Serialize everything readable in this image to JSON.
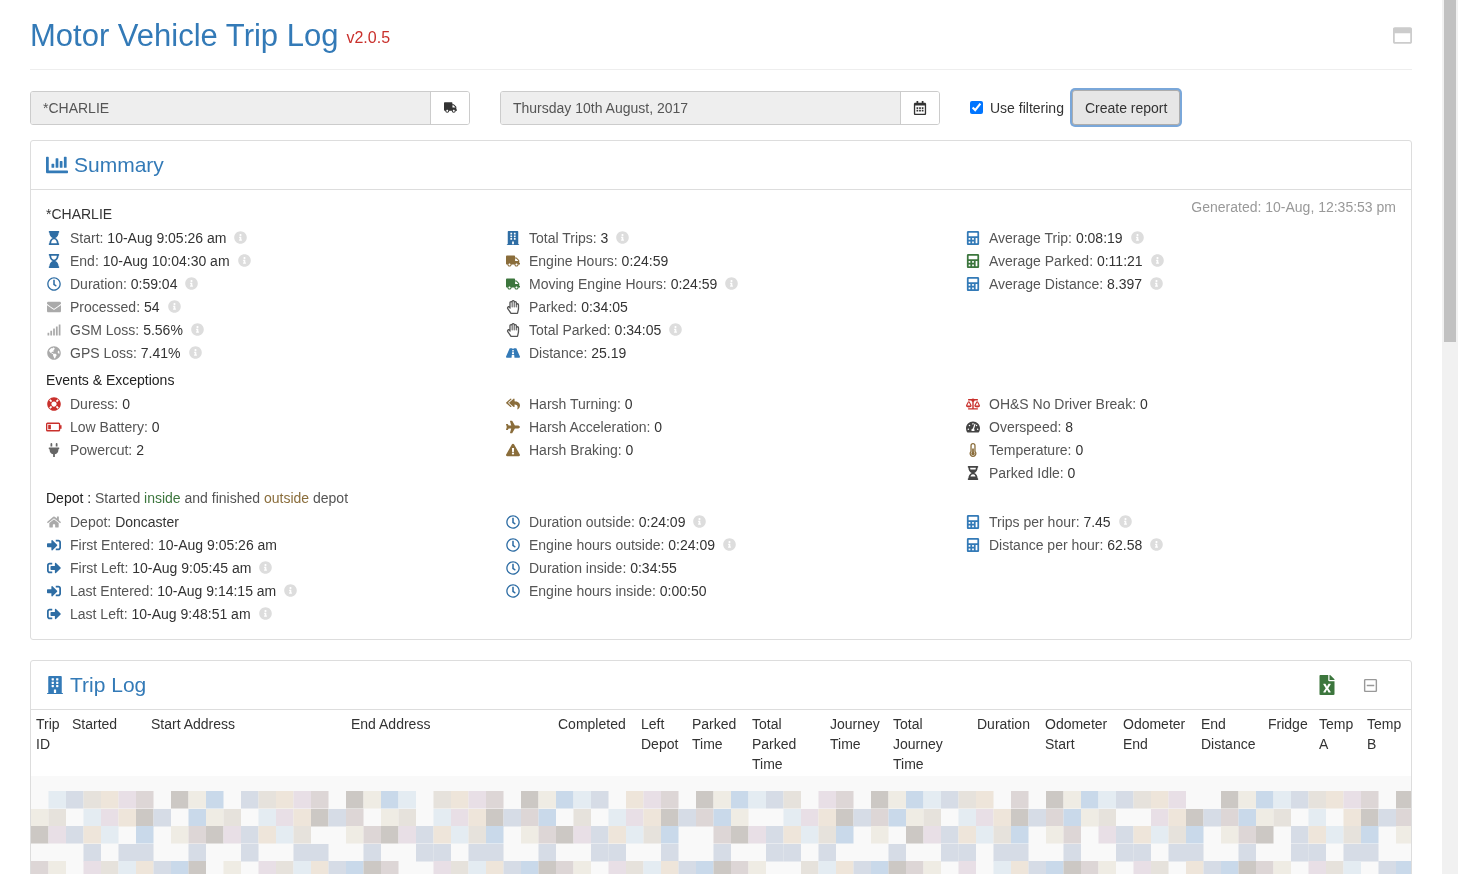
{
  "header": {
    "title": "Motor Vehicle Trip Log",
    "version": "v2.0.5"
  },
  "toolbar": {
    "vehicle_field": {
      "value": "*CHARLIE"
    },
    "date_field": {
      "value": "Thursday 10th August, 2017"
    },
    "use_filtering": {
      "label": "Use filtering",
      "checked": true
    },
    "create_report": {
      "label": "Create report"
    }
  },
  "summary": {
    "title": "Summary",
    "vehicle": "*CHARLIE",
    "generated": "Generated: 10-Aug, 12:35:53 pm",
    "groups": [
      {
        "columns": [
          [
            {
              "label": "Start:",
              "value": "10-Aug 9:05:26 am",
              "info": true
            },
            {
              "label": "End:",
              "value": "10-Aug 10:04:30 am",
              "info": true
            },
            {
              "label": "Duration:",
              "value": "0:59:04",
              "info": true
            },
            {
              "label": "Processed:",
              "value": "54",
              "info": true
            },
            {
              "label": "GSM Loss:",
              "value": "5.56%",
              "info": true
            },
            {
              "label": "GPS Loss:",
              "value": "7.41%",
              "info": true
            }
          ],
          [
            {
              "label": "Total Trips:",
              "value": "3",
              "info": true
            },
            {
              "label": "Engine Hours:",
              "value": "0:24:59",
              "info": false
            },
            {
              "label": "Moving Engine Hours:",
              "value": "0:24:59",
              "info": true
            },
            {
              "label": "Parked:",
              "value": "0:34:05",
              "info": false
            },
            {
              "label": "Total Parked:",
              "value": "0:34:05",
              "info": true
            },
            {
              "label": "Distance:",
              "value": "25.19",
              "info": false
            }
          ],
          [
            {
              "label": "Average Trip:",
              "value": "0:08:19",
              "info": true
            },
            {
              "label": "Average Parked:",
              "value": "0:11:21",
              "info": true
            },
            {
              "label": "Average Distance:",
              "value": "8.397",
              "info": true
            }
          ]
        ]
      },
      {
        "heading": [
          {
            "text": "Events & Exceptions",
            "kind": "plain"
          }
        ],
        "columns": [
          [
            {
              "label": "Duress:",
              "value": "0",
              "info": false
            },
            {
              "label": "Low Battery:",
              "value": "0",
              "info": false
            },
            {
              "label": "Powercut:",
              "value": "2",
              "info": false
            }
          ],
          [
            {
              "label": "Harsh Turning:",
              "value": "0",
              "info": false
            },
            {
              "label": "Harsh Acceleration:",
              "value": "0",
              "info": false
            },
            {
              "label": "Harsh Braking:",
              "value": "0",
              "info": false
            }
          ],
          [
            {
              "label": "OH&S No Driver Break:",
              "value": "0",
              "info": false
            },
            {
              "label": "Overspeed:",
              "value": "8",
              "info": false
            },
            {
              "label": "Temperature:",
              "value": "0",
              "info": false
            },
            {
              "label": "Parked Idle:",
              "value": "0",
              "info": false
            }
          ]
        ]
      },
      {
        "heading": [
          {
            "text": "Depot : ",
            "kind": "plain"
          },
          {
            "text": "Started ",
            "kind": "muted"
          },
          {
            "text": "inside",
            "kind": "good"
          },
          {
            "text": " and finished ",
            "kind": "muted"
          },
          {
            "text": "outside",
            "kind": "warn"
          },
          {
            "text": " depot",
            "kind": "muted"
          }
        ],
        "columns": [
          [
            {
              "label": "Depot:",
              "value": "Doncaster",
              "info": false
            },
            {
              "label": "First Entered:",
              "value": "10-Aug 9:05:26 am",
              "info": false
            },
            {
              "label": "First Left:",
              "value": "10-Aug 9:05:45 am",
              "info": true
            },
            {
              "label": "Last Entered:",
              "value": "10-Aug 9:14:15 am",
              "info": true
            },
            {
              "label": "Last Left:",
              "value": "10-Aug 9:48:51 am",
              "info": true
            }
          ],
          [
            {
              "label": "Duration outside:",
              "value": "0:24:09",
              "info": true
            },
            {
              "label": "Engine hours outside:",
              "value": "0:24:09",
              "info": true
            },
            {
              "label": "Duration inside:",
              "value": "0:34:55",
              "info": false
            },
            {
              "label": "Engine hours inside:",
              "value": "0:00:50",
              "info": false
            }
          ],
          [
            {
              "label": "Trips per hour:",
              "value": "7.45",
              "info": true
            },
            {
              "label": "Distance per hour:",
              "value": "62.58",
              "info": true
            }
          ]
        ]
      }
    ]
  },
  "trip_log": {
    "title": "Trip Log",
    "columns": [
      "Trip ID",
      "Started",
      "Start Address",
      "End Address",
      "Completed",
      "Left Depot",
      "Parked Time",
      "Total Parked Time",
      "Journey Time",
      "Total Journey Time",
      "Duration",
      "Odometer Start",
      "Odometer End",
      "End Distance",
      "Fridge",
      "Temp A",
      "Temp B"
    ]
  }
}
